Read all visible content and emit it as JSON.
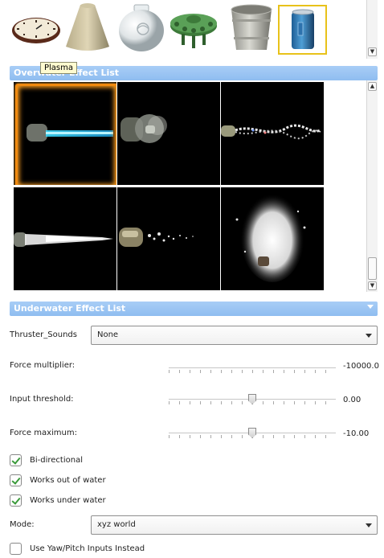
{
  "object_picker": {
    "items": [
      {
        "name": "wall-clock"
      },
      {
        "name": "stone-cone"
      },
      {
        "name": "porcelain-jar"
      },
      {
        "name": "green-mine"
      },
      {
        "name": "metal-bucket"
      },
      {
        "name": "soda-can",
        "selected": true
      }
    ]
  },
  "tooltip": "Plasma",
  "overwater_section": {
    "title": "Overwater Effect List"
  },
  "effects": [
    {
      "name": "plasma",
      "selected": true
    },
    {
      "name": "smoke-puff"
    },
    {
      "name": "spray-trail"
    },
    {
      "name": "white-stream"
    },
    {
      "name": "bubble-trail"
    },
    {
      "name": "splash-burst"
    }
  ],
  "underwater_section": {
    "title": "Underwater Effect List"
  },
  "thruster_sounds": {
    "label": "Thruster_Sounds",
    "value": "None"
  },
  "force_multiplier": {
    "label": "Force multiplier:",
    "value": "-10000.0"
  },
  "input_threshold": {
    "label": "Input threshold:",
    "value": "0.00",
    "position": 0.5
  },
  "force_maximum": {
    "label": "Force maximum:",
    "value": "-10.00",
    "position": 0.5
  },
  "bidirectional": {
    "label": "Bi-directional",
    "checked": true
  },
  "works_out_of_water": {
    "label": "Works out of water",
    "checked": true
  },
  "works_under_water": {
    "label": "Works under water",
    "checked": true
  },
  "mode": {
    "label": "Mode:",
    "value": "xyz world"
  },
  "yaw_pitch": {
    "label": "Use Yaw/Pitch Inputs Instead",
    "checked": false
  },
  "colors": {
    "header": "#96c2f2",
    "selection_border": "#e8c21a",
    "effect_highlight": "#f08a10",
    "check": "#3a9a3a"
  }
}
